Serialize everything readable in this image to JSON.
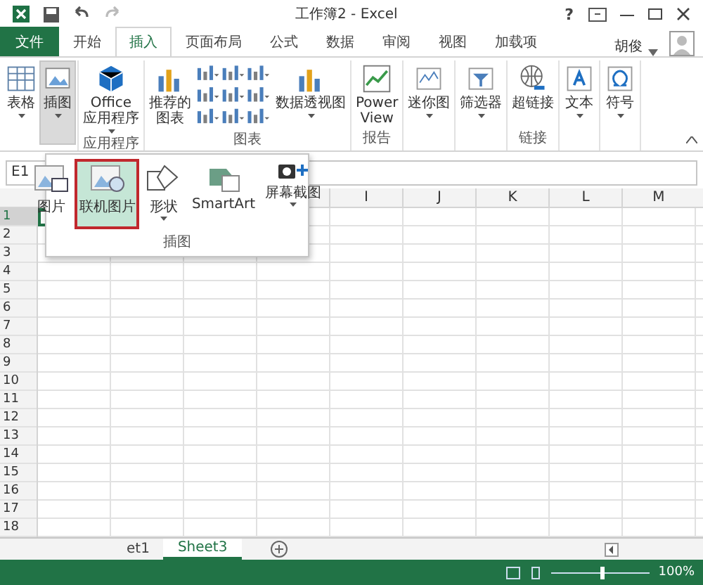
{
  "title_bar": {
    "title": "工作簿2 - Excel",
    "help": "?"
  },
  "ribbon_tabs": [
    {
      "label": "文件",
      "kind": "file",
      "selected": false
    },
    {
      "label": "开始",
      "kind": "tab",
      "selected": false
    },
    {
      "label": "插入",
      "kind": "tab",
      "selected": true
    },
    {
      "label": "页面布局",
      "kind": "tab",
      "selected": false
    },
    {
      "label": "公式",
      "kind": "tab",
      "selected": false
    },
    {
      "label": "数据",
      "kind": "tab",
      "selected": false
    },
    {
      "label": "审阅",
      "kind": "tab",
      "selected": false
    },
    {
      "label": "视图",
      "kind": "tab",
      "selected": false
    },
    {
      "label": "加载项",
      "kind": "tab",
      "selected": false
    }
  ],
  "account": {
    "name": "胡俊"
  },
  "ribbon_groups": [
    {
      "buttons": [
        {
          "lines": [
            "表格"
          ],
          "caret": true,
          "pressed": false
        },
        {
          "lines": [
            "插图"
          ],
          "caret": true,
          "pressed": true
        }
      ]
    },
    {
      "label": "应用程序",
      "buttons": [
        {
          "lines": [
            "Office",
            "应用程序"
          ],
          "caret": true,
          "pressed": false
        }
      ]
    },
    {
      "label": "图表",
      "buttons": [
        {
          "lines": [
            "推荐的",
            "图表"
          ],
          "caret": false,
          "pressed": false
        },
        {
          "kind": "chart-grid"
        },
        {
          "lines": [
            "数据透视图"
          ],
          "caret": true,
          "pressed": false
        }
      ]
    },
    {
      "label": "报告",
      "buttons": [
        {
          "lines": [
            "Power",
            "View"
          ],
          "caret": false,
          "pressed": false
        }
      ]
    },
    {
      "buttons": [
        {
          "lines": [
            "迷你图"
          ],
          "caret": true,
          "pressed": false
        }
      ]
    },
    {
      "buttons": [
        {
          "lines": [
            "筛选器"
          ],
          "caret": true,
          "pressed": false
        }
      ]
    },
    {
      "label": "链接",
      "buttons": [
        {
          "lines": [
            "超链接"
          ],
          "caret": false,
          "pressed": false
        }
      ]
    },
    {
      "buttons": [
        {
          "lines": [
            "文本"
          ],
          "caret": true,
          "pressed": false
        }
      ]
    },
    {
      "buttons": [
        {
          "lines": [
            "符号"
          ],
          "caret": true,
          "pressed": false
        }
      ]
    }
  ],
  "name_box": {
    "value": "E1"
  },
  "dropdown": {
    "label": "插图",
    "items": [
      {
        "label": "图片",
        "caret": false,
        "selected": false
      },
      {
        "label": "联机图片",
        "caret": false,
        "selected": true
      },
      {
        "label": "形状",
        "caret": true,
        "selected": false
      },
      {
        "label": "SmartArt",
        "caret": false,
        "selected": false
      },
      {
        "label": "屏幕截图",
        "caret": true,
        "selected": false
      }
    ]
  },
  "columns": [
    "I",
    "J",
    "K",
    "L",
    "M"
  ],
  "rows": [
    {
      "label": "1",
      "selected": true
    },
    {
      "label": "2",
      "selected": false
    },
    {
      "label": "3",
      "selected": false
    },
    {
      "label": "4",
      "selected": false
    },
    {
      "label": "5",
      "selected": false
    },
    {
      "label": "6",
      "selected": false
    },
    {
      "label": "7",
      "selected": false
    },
    {
      "label": "8",
      "selected": false
    },
    {
      "label": "9",
      "selected": false
    },
    {
      "label": "10",
      "selected": false
    },
    {
      "label": "11",
      "selected": false
    },
    {
      "label": "12",
      "selected": false
    },
    {
      "label": "13",
      "selected": false
    },
    {
      "label": "14",
      "selected": false
    },
    {
      "label": "15",
      "selected": false
    },
    {
      "label": "16",
      "selected": false
    },
    {
      "label": "17",
      "selected": false
    },
    {
      "label": "18",
      "selected": false
    }
  ],
  "sheet_tabs": [
    {
      "label": "et1",
      "selected": false
    },
    {
      "label": "Sheet3",
      "selected": true
    }
  ],
  "status_bar": {
    "zoom": "100%",
    "level": 0.5
  }
}
